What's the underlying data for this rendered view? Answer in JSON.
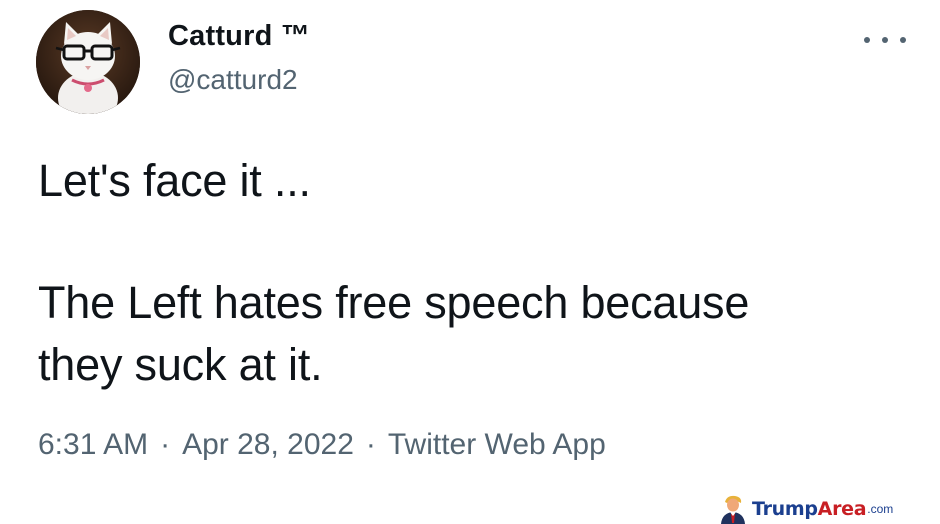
{
  "author": {
    "display_name": "Catturd ™",
    "handle": "@catturd2"
  },
  "tweet": {
    "line_1": "Let's face it ...",
    "line_2": "The Left hates free speech because",
    "line_3": "they suck at it."
  },
  "meta": {
    "time": "6:31 AM",
    "separator": "·",
    "date": "Apr 28, 2022",
    "source": "Twitter Web App"
  },
  "watermark": {
    "brand_part_1": "Trump",
    "brand_part_2": "Area",
    "suffix": ".com"
  },
  "icons": {
    "more": "more-options-icon",
    "avatar": "cat-with-glasses-avatar",
    "watermark": "trump-figure-icon"
  },
  "colors": {
    "text_primary": "#0f1419",
    "text_secondary": "#536471",
    "watermark_blue": "#1b3f8f",
    "watermark_red": "#c81f24"
  }
}
